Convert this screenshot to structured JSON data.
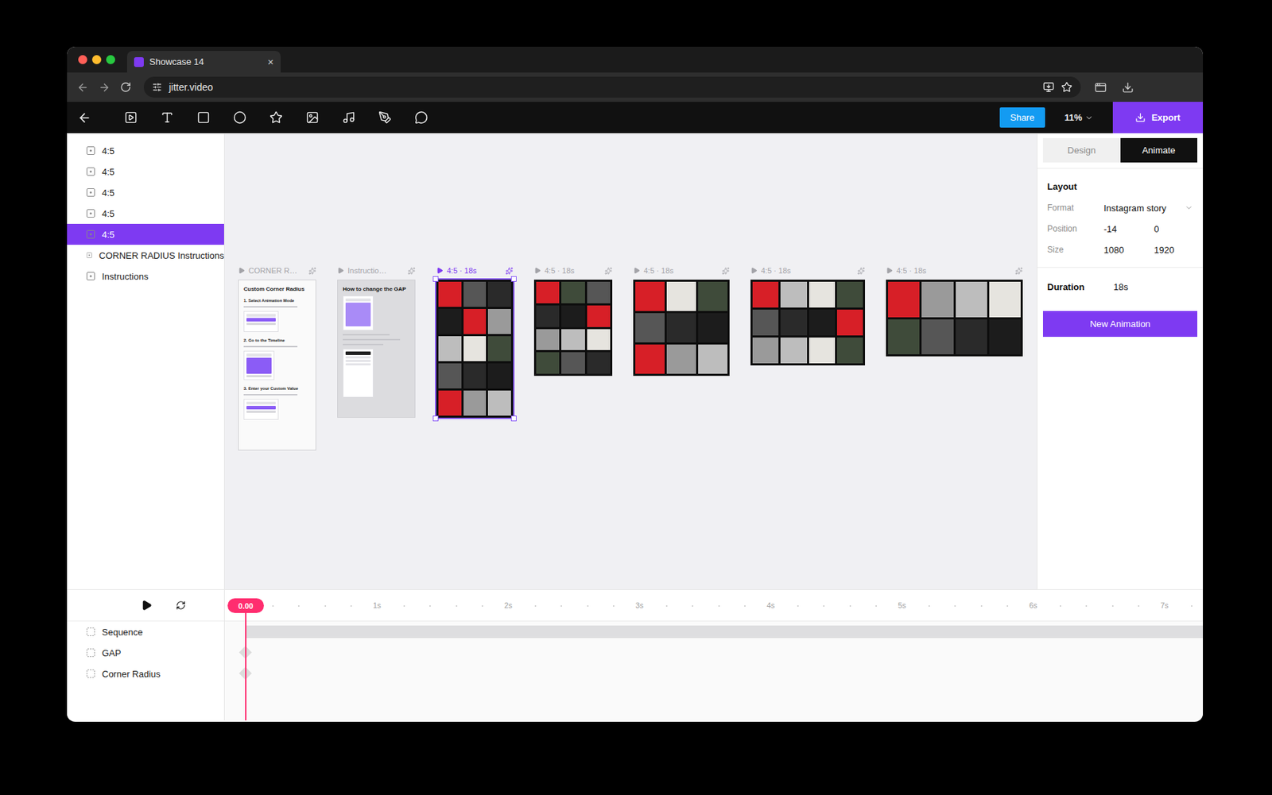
{
  "browser": {
    "tab": {
      "title": "Showcase 14",
      "close": "×"
    },
    "url": "jitter.video"
  },
  "toolbar": {
    "share": "Share",
    "zoom": "11%",
    "export": "Export"
  },
  "layers": [
    {
      "label": "4:5",
      "selected": false
    },
    {
      "label": "4:5",
      "selected": false
    },
    {
      "label": "4:5",
      "selected": false
    },
    {
      "label": "4:5",
      "selected": false
    },
    {
      "label": "4:5",
      "selected": true
    },
    {
      "label": "CORNER RADIUS Instructions",
      "selected": false
    },
    {
      "label": "Instructions",
      "selected": false
    }
  ],
  "artboards": [
    {
      "kind": "doc",
      "label": "CORNER R…",
      "selected": false,
      "title": "Custom Corner Radius",
      "steps": [
        "1. Select Animation Mode",
        "2. Go to the Timeline",
        "3. Enter your Custom Value"
      ]
    },
    {
      "kind": "doc",
      "label": "Instructio…",
      "selected": false,
      "title": "How to change the GAP",
      "steps": []
    },
    {
      "kind": "video",
      "label": "4:5 · 18s",
      "selected": true,
      "title": "",
      "steps": []
    },
    {
      "kind": "video",
      "label": "4:5 · 18s",
      "selected": false,
      "title": "",
      "steps": []
    },
    {
      "kind": "video",
      "label": "4:5 · 18s",
      "selected": false,
      "title": "",
      "steps": []
    },
    {
      "kind": "video",
      "label": "4:5 · 18s",
      "selected": false,
      "title": "",
      "steps": []
    },
    {
      "kind": "video",
      "label": "4:5 · 18s",
      "selected": false,
      "title": "",
      "steps": []
    }
  ],
  "panel": {
    "tabs": [
      {
        "label": "Design",
        "selected": false
      },
      {
        "label": "Animate",
        "selected": true
      }
    ],
    "heading": "Layout",
    "format": {
      "label": "Format",
      "value": "Instagram story"
    },
    "position": {
      "label": "Position",
      "x": "-14",
      "y": "0"
    },
    "size": {
      "label": "Size",
      "w": "1080",
      "h": "1920"
    },
    "duration": {
      "label": "Duration",
      "value": "18s"
    },
    "button": "New Animation"
  },
  "timeline": {
    "time": "0.00",
    "ticks": [
      "1s",
      "2s",
      "3s",
      "4s",
      "5s",
      "6s",
      "7s"
    ],
    "tracks": [
      {
        "label": "Sequence",
        "kind": "bar"
      },
      {
        "label": "GAP",
        "kind": "keyframe"
      },
      {
        "label": "Corner Radius",
        "kind": "keyframe"
      }
    ]
  }
}
